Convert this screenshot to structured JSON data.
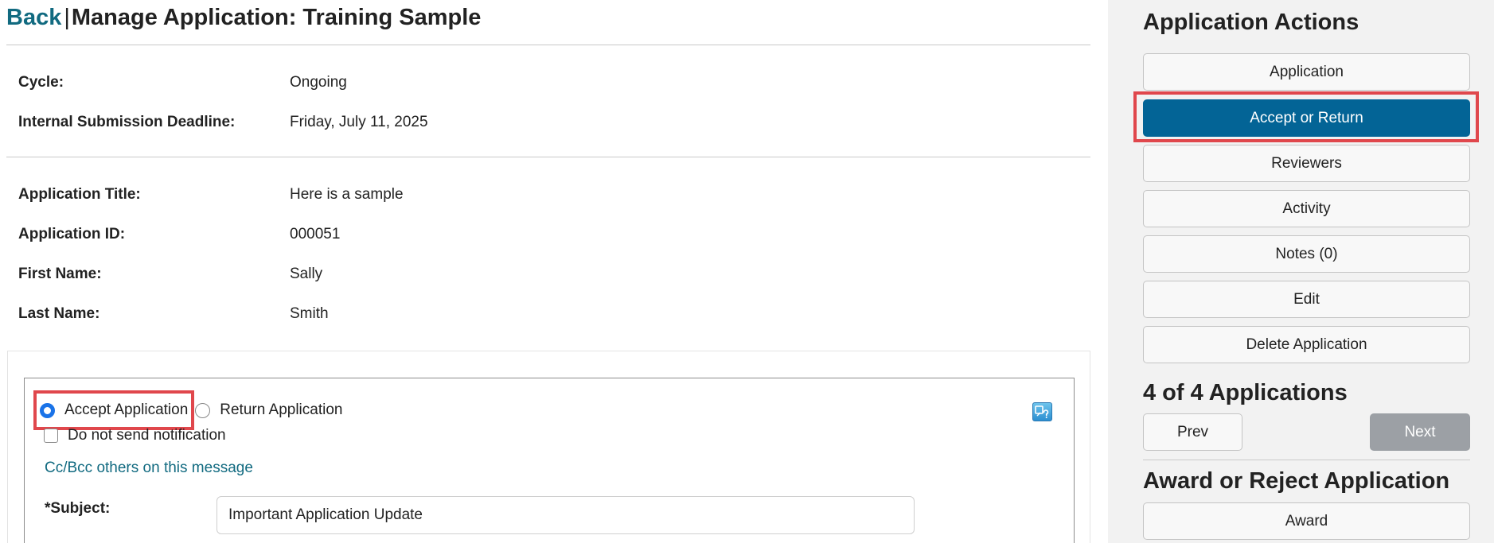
{
  "header": {
    "back_label": "Back",
    "separator": "|",
    "title": "Manage Application: Training Sample"
  },
  "cycle_info": [
    {
      "label": "Cycle:",
      "value": "Ongoing"
    },
    {
      "label": "Internal Submission Deadline:",
      "value": "Friday, July 11, 2025"
    }
  ],
  "application_info": [
    {
      "label": "Application Title:",
      "value": "Here is a sample"
    },
    {
      "label": "Application ID:",
      "value": "000051"
    },
    {
      "label": "First Name:",
      "value": "Sally"
    },
    {
      "label": "Last Name:",
      "value": "Smith"
    }
  ],
  "form": {
    "radio_accept_label": "Accept Application",
    "radio_return_label": "Return Application",
    "selected_option": "accept",
    "no_notification_label": "Do not send notification",
    "no_notification_checked": false,
    "cc_link": "Cc/Bcc others on this message",
    "subject_label": "*Subject:",
    "subject_value": "Important Application Update"
  },
  "sidebar": {
    "actions_heading": "Application Actions",
    "actions": [
      {
        "label": "Application",
        "active": false
      },
      {
        "label": "Accept or Return",
        "active": true
      },
      {
        "label": "Reviewers",
        "active": false
      },
      {
        "label": "Activity",
        "active": false
      },
      {
        "label": "Notes (0)",
        "active": false
      },
      {
        "label": "Edit",
        "active": false
      },
      {
        "label": "Delete Application",
        "active": false
      }
    ],
    "count_heading": "4 of 4 Applications",
    "prev_label": "Prev",
    "next_label": "Next",
    "award_heading": "Award or Reject Application",
    "award_label": "Award"
  },
  "colors": {
    "link": "#116a80",
    "active_button": "#036496",
    "disabled_button": "#9ca0a5",
    "highlight": "#e0474c",
    "radio_checked": "#1a73e8",
    "sidebar_bg": "#f2f2f2"
  },
  "icons": {
    "help": "help-question-icon"
  }
}
